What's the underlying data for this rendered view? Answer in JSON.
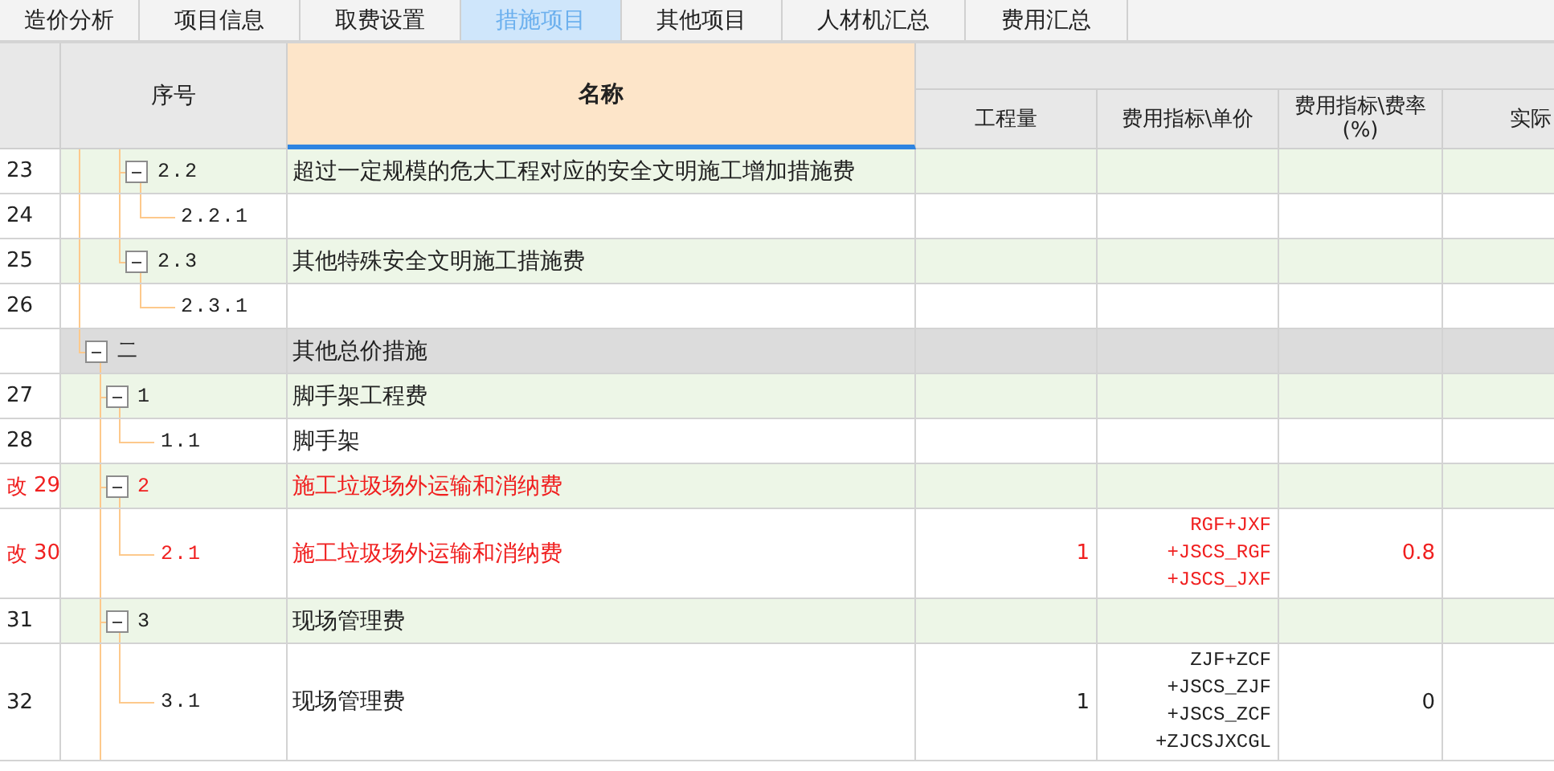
{
  "tabs": [
    {
      "label": "造价分析",
      "selected": false
    },
    {
      "label": "项目信息",
      "selected": false
    },
    {
      "label": "取费设置",
      "selected": false
    },
    {
      "label": "措施项目",
      "selected": true
    },
    {
      "label": "其他项目",
      "selected": false
    },
    {
      "label": "人材机汇总",
      "selected": false
    },
    {
      "label": "费用汇总",
      "selected": false
    }
  ],
  "table": {
    "columns": [
      {
        "label": "序号"
      },
      {
        "label": "名称"
      },
      {
        "label": "工程量"
      },
      {
        "label": "费用指标\\单价"
      },
      {
        "label": "费用指标\\费率(%)"
      },
      {
        "label": "实际"
      }
    ],
    "rows": [
      {
        "children": [
          {
            "children": [
              {
                "kind": "item",
                "row_number": "23",
                "seq": "2.2",
                "name": "超过一定规模的危大工程对应的安全文明施工增加措施费",
                "expanded": true,
                "modified": false,
                "children": [
                  {
                    "kind": "item",
                    "row_number": "24",
                    "seq": "2.2.1",
                    "modified": false
                  }
                ]
              },
              {
                "kind": "item",
                "row_number": "25",
                "seq": "2.3",
                "name": "其他特殊安全文明施工措施费",
                "expanded": true,
                "modified": false,
                "children": [
                  {
                    "kind": "item",
                    "row_number": "26",
                    "seq": "2.3.1",
                    "modified": false
                  }
                ]
              }
            ]
          }
        ]
      },
      {
        "kind": "section",
        "seq": "二",
        "name": "其他总价措施",
        "expanded": true,
        "modified": false,
        "continues": true,
        "children": [
          {
            "kind": "item",
            "row_number": "27",
            "seq": "1",
            "name": "脚手架工程费",
            "expanded": true,
            "modified": false,
            "children": [
              {
                "kind": "item",
                "row_number": "28",
                "seq": "1.1",
                "name": "脚手架",
                "modified": false
              }
            ]
          },
          {
            "kind": "item",
            "flag": "改",
            "row_number": "29",
            "seq": "2",
            "name": "施工垃圾场外运输和消纳费",
            "expanded": true,
            "modified": true,
            "children": [
              {
                "kind": "item",
                "flag": "改",
                "row_number": "30",
                "seq": "2.1",
                "name": "施工垃圾场外运输和消纳费",
                "quantity": "1",
                "unit_price": "RGF+JXF\n+JSCS_RGF\n+JSCS_JXF",
                "rate": "0.8",
                "modified": true
              }
            ]
          },
          {
            "kind": "item",
            "row_number": "31",
            "seq": "3",
            "name": "现场管理费",
            "expanded": true,
            "modified": false,
            "children": [
              {
                "kind": "item",
                "row_number": "32",
                "seq": "3.1",
                "name": "现场管理费",
                "quantity": "1",
                "unit_price": "ZJF+ZCF\n+JSCS_ZJF\n+JSCS_ZCF\n+ZJCSJXCGL",
                "rate": "0",
                "modified": false
              }
            ]
          }
        ]
      }
    ]
  }
}
